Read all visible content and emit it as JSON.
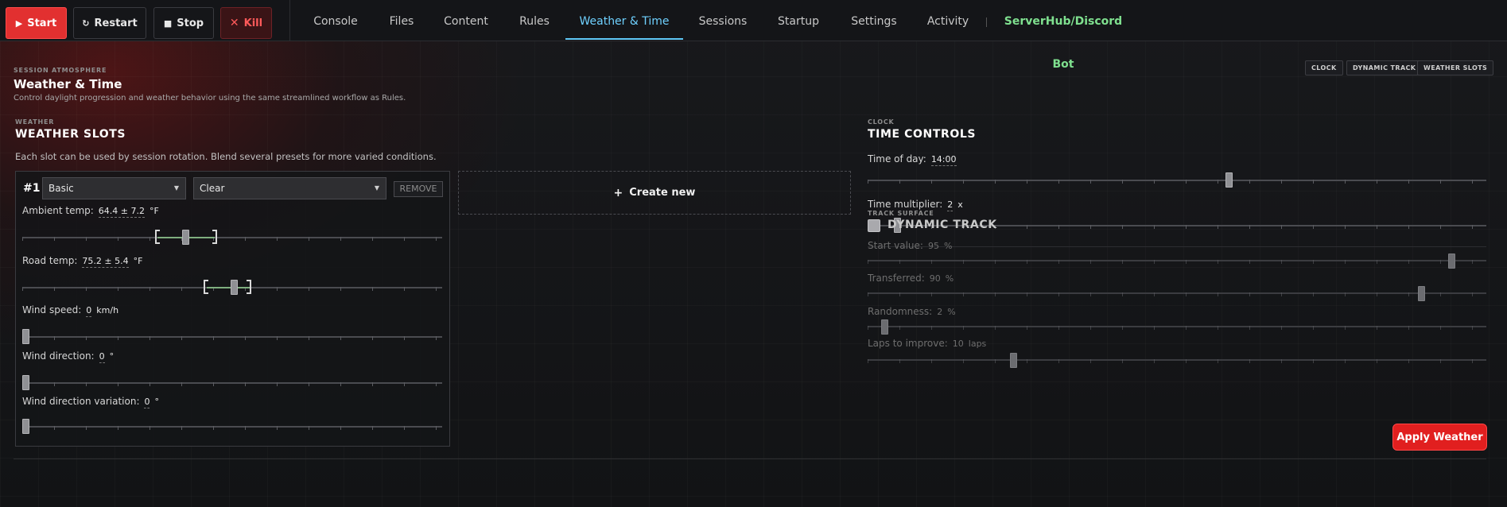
{
  "controls": {
    "start_label": "Start",
    "restart_label": "Restart",
    "stop_label": "Stop",
    "kill_label": "Kill"
  },
  "tabs": [
    {
      "label": "Console"
    },
    {
      "label": "Files"
    },
    {
      "label": "Content"
    },
    {
      "label": "Rules"
    },
    {
      "label": "Weather & Time",
      "active": true
    },
    {
      "label": "Sessions"
    },
    {
      "label": "Startup"
    },
    {
      "label": "Settings"
    },
    {
      "label": "Activity"
    },
    {
      "label": "ServerHub/Discord Bot"
    }
  ],
  "header": {
    "eyebrow": "SESSION ATMOSPHERE",
    "title": "Weather & Time",
    "description": "Control daylight progression and weather behavior using the same streamlined workflow as Rules.",
    "pills": [
      "CLOCK",
      "DYNAMIC TRACK",
      "WEATHER SLOTS"
    ]
  },
  "weather": {
    "eyebrow": "WEATHER",
    "title": "WEATHER SLOTS",
    "description": "Each slot can be used by session rotation. Blend several presets for more varied conditions.",
    "create_new_label": "Create new",
    "slot": {
      "number": "#1",
      "preset": "Basic",
      "condition": "Clear",
      "remove_label": "REMOVE",
      "fields": [
        {
          "label": "Ambient temp:",
          "value": "64.4 ± 7.2",
          "unit": "°F",
          "level": 0.41
        },
        {
          "label": "Road temp:",
          "value": "75.2 ± 5.4",
          "unit": "°F",
          "level": 0.51
        },
        {
          "label": "Wind speed:",
          "value": "0",
          "unit": "km/h",
          "level": 0.0
        },
        {
          "label": "Wind direction:",
          "value": "0",
          "unit": "°",
          "level": 0.0
        },
        {
          "label": "Wind direction variation:",
          "value": "0",
          "unit": "°",
          "level": 0.0
        }
      ]
    }
  },
  "clock": {
    "eyebrow": "CLOCK",
    "title": "TIME CONTROLS",
    "time_of_day": {
      "label": "Time of day:",
      "value": "14:00",
      "level": 0.58
    },
    "time_multiplier": {
      "label": "Time multiplier:",
      "value": "2",
      "unit": "x",
      "level": 0.04
    }
  },
  "track": {
    "eyebrow": "TRACK SURFACE",
    "title": "DYNAMIC TRACK",
    "enabled": false,
    "fields": [
      {
        "label": "Start value:",
        "value": "95",
        "unit": "%",
        "level": 0.94
      },
      {
        "label": "Transferred:",
        "value": "90",
        "unit": "%",
        "level": 0.89
      },
      {
        "label": "Randomness:",
        "value": "2",
        "unit": "%",
        "level": 0.02
      },
      {
        "label": "Laps to improve:",
        "value": "10",
        "unit": "laps",
        "level": 0.23
      }
    ]
  },
  "apply_label": "Apply Weather",
  "colors": {
    "accent_red": "#e11f1f",
    "active_tab": "#6fd1ff",
    "bot_tab": "#7fe08f"
  }
}
